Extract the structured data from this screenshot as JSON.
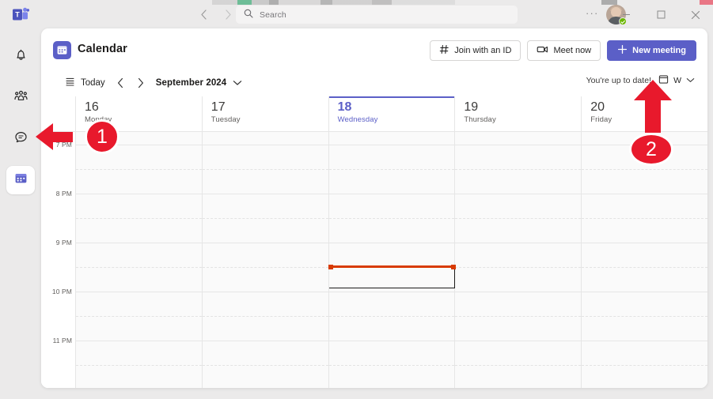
{
  "window": {
    "back_icon": "chevron-left-icon",
    "forward_icon": "chevron-right-icon",
    "more_label": "···",
    "minimize_label": "—",
    "maximize_label": "□",
    "close_label": "✕",
    "presence_status": "available"
  },
  "search": {
    "placeholder": "Search",
    "value": "",
    "icon": "search-icon"
  },
  "rail": {
    "items": [
      {
        "name": "activity",
        "icon": "bell-icon",
        "active": false
      },
      {
        "name": "teams",
        "icon": "people-icon",
        "active": false
      },
      {
        "name": "chat",
        "icon": "chat-bubble-icon",
        "active": false
      },
      {
        "name": "calendar",
        "icon": "calendar-icon",
        "active": true
      }
    ]
  },
  "header": {
    "app_icon": "calendar-icon",
    "title": "Calendar",
    "actions": [
      {
        "key": "join_with_id",
        "label": "Join with an ID",
        "icon": "hash-icon",
        "primary": false
      },
      {
        "key": "meet_now",
        "label": "Meet now",
        "icon": "video-camera-icon",
        "primary": false
      },
      {
        "key": "new_meeting",
        "label": "New meeting",
        "icon": "plus-icon",
        "primary": true
      }
    ]
  },
  "toolbar": {
    "today_label": "Today",
    "today_icon": "today-icon",
    "prev_icon": "chevron-left-icon",
    "next_icon": "chevron-right-icon",
    "month_label": "September 2024",
    "month_chevron_icon": "chevron-down-icon",
    "up_to_date_label": "You're up to date!",
    "view_icon": "view-layout-icon",
    "view_label": "W",
    "view_chevron_icon": "chevron-down-icon"
  },
  "calendar": {
    "colors": {
      "accent": "#5b5fc7",
      "today_text": "#5b5fc7",
      "now_line": "#d83b01",
      "grid_line": "#e6e6e6",
      "grid_bg": "#fafafa"
    },
    "days": [
      {
        "num": "16",
        "name": "Monday",
        "today": false
      },
      {
        "num": "17",
        "name": "Tuesday",
        "today": false
      },
      {
        "num": "18",
        "name": "Wednesday",
        "today": true
      },
      {
        "num": "19",
        "name": "Thursday",
        "today": false
      },
      {
        "num": "20",
        "name": "Friday",
        "today": false
      }
    ],
    "times": [
      "7 PM",
      "8 PM",
      "9 PM",
      "10 PM",
      "11 PM"
    ],
    "now_marker": {
      "day_index": 2,
      "label": ""
    }
  },
  "annotations": [
    {
      "id": "1",
      "label": "1",
      "target": "calendar-rail-item",
      "direction": "left"
    },
    {
      "id": "2",
      "label": "2",
      "target": "new-meeting-button",
      "direction": "up"
    }
  ]
}
